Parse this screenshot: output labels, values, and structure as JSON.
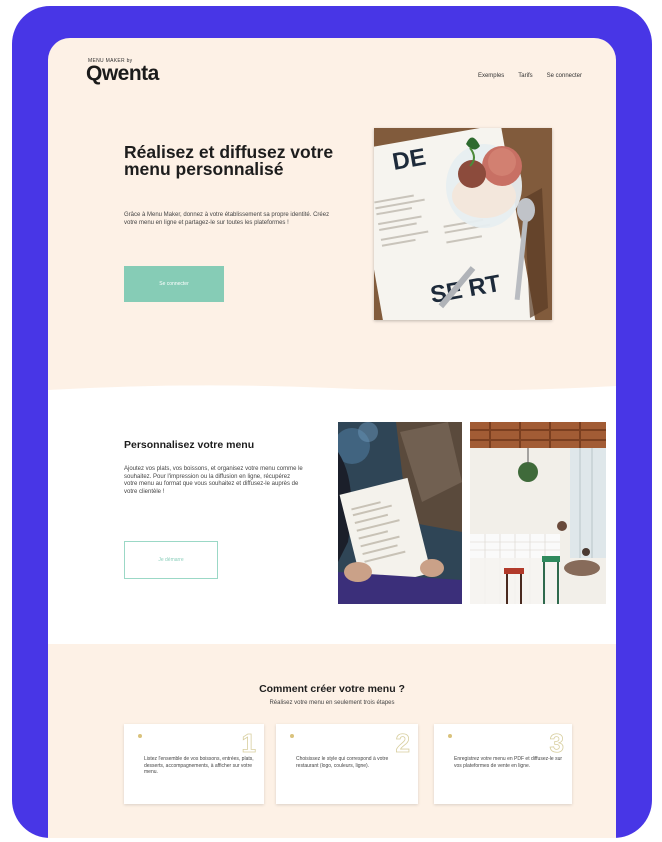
{
  "header": {
    "brand_tag": "MENU MAKER by",
    "logo": "Qwenta",
    "nav": [
      "Exemples",
      "Tarifs",
      "Se connecter"
    ]
  },
  "hero": {
    "title": "Réalisez et diffusez votre menu personnalisé",
    "description": "Grâce à Menu Maker, donnez à votre établissement sa propre identité. Créez votre menu en ligne et partagez-le sur toutes les plateformes !",
    "button_label": "Se connecter",
    "photo_text_top": "DE",
    "photo_text_bottom": "SE RT"
  },
  "customize": {
    "title": "Personnalisez votre menu",
    "description": "Ajoutez vos plats, vos boissons, et organisez votre menu comme le souhaitez. Pour l'impression ou la diffusion en ligne, récupérez votre menu au format que vous souhaitez et diffusez-le auprès de votre clientèle !",
    "button_label": "Je démarre"
  },
  "steps": {
    "title": "Comment créer votre menu ?",
    "subtitle": "Réalisez votre menu en seulement trois étapes",
    "items": [
      {
        "number": "1",
        "text": "Listez l'ensemble de vos boissons, entrées, plats, desserts, accompagnements, à afficher sur votre menu."
      },
      {
        "number": "2",
        "text": "Choisissez le style qui correspond à votre restaurant (logo, couleurs, ligne)."
      },
      {
        "number": "3",
        "text": "Enregistrez votre menu en PDF et diffusez-le sur vos plateformes de vente en ligne."
      }
    ]
  },
  "colors": {
    "frame": "#4836e6",
    "background": "#fdf1e6",
    "accent": "#86ccb6"
  }
}
